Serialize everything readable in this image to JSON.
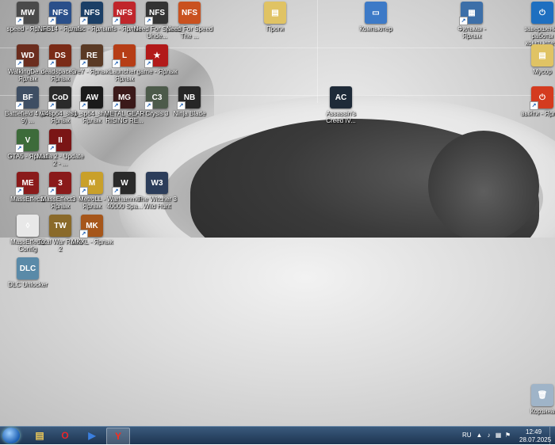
{
  "desktop": {
    "icons": [
      {
        "name": "speed-icon",
        "label": "speed - Ярлык",
        "glyph": "MW",
        "bg": "#4a4a4a",
        "shortcut": true
      },
      {
        "name": "nfs14-icon",
        "label": "NFS14 - Ярлык",
        "glyph": "NFS",
        "bg": "#2a4f8a",
        "shortcut": true
      },
      {
        "name": "nfsc-icon",
        "label": "nfsc - Ярлык",
        "glyph": "NFS",
        "bg": "#1b3f66",
        "shortcut": true
      },
      {
        "name": "nfs-icon",
        "label": "nfs - Ярлык",
        "glyph": "NFS",
        "bg": "#c0262b",
        "shortcut": true
      },
      {
        "name": "nfs-undercover-icon",
        "label": "Need For Speed Unde...",
        "glyph": "NFS",
        "bg": "#333333",
        "shortcut": true
      },
      {
        "name": "nfs-the-run-icon",
        "label": "Need For Speed The ...",
        "glyph": "NFS",
        "bg": "#c9511f",
        "shortcut": false
      },
      {
        "name": "walkingdead-icon",
        "label": "WalkingDe... - Ярлык",
        "glyph": "WD",
        "bg": "#6b2d1e",
        "shortcut": true
      },
      {
        "name": "deadspace3-icon",
        "label": "deadspace3 - Ярлык",
        "glyph": "DS",
        "bg": "#7a2b17",
        "shortcut": true
      },
      {
        "name": "re7-icon",
        "label": "re7 - Ярлык",
        "glyph": "RE",
        "bg": "#5a3a25",
        "shortcut": true
      },
      {
        "name": "launcher-icon",
        "label": "Launcher - Ярлык",
        "glyph": "L",
        "bg": "#b63d16",
        "shortcut": true
      },
      {
        "name": "game-icon",
        "label": "game - Ярлык",
        "glyph": "★",
        "bg": "#b21a1a",
        "shortcut": true
      },
      {
        "name": "battlefield4-icon",
        "label": "Battlefield 4 (DX 9) ...",
        "glyph": "BF",
        "bg": "#3e4e63",
        "shortcut": true
      },
      {
        "name": "mw2-ship-icon",
        "label": "iw4sp64_ship - Ярлык",
        "glyph": "CoD",
        "bg": "#2a2a2a",
        "shortcut": true
      },
      {
        "name": "s1-ship-icon",
        "label": "s1_sp64_ship - Ярлык",
        "glyph": "AW",
        "bg": "#1a1a1a",
        "shortcut": true
      },
      {
        "name": "metal-gear-icon",
        "label": "METAL GEAR RISING RE...",
        "glyph": "MG",
        "bg": "#3b1a1a",
        "shortcut": true
      },
      {
        "name": "crysis3-icon",
        "label": "Crysis 3",
        "glyph": "C3",
        "bg": "#4c5a4a",
        "shortcut": true
      },
      {
        "name": "ninja-blade-icon",
        "label": "Ninja Blade",
        "glyph": "NB",
        "bg": "#262626",
        "shortcut": true
      },
      {
        "name": "gta5-icon",
        "label": "GTA5 - Ярлык",
        "glyph": "V",
        "bg": "#3d6b3a",
        "shortcut": true
      },
      {
        "name": "mafia2-icon",
        "label": "Mafia 2 - Update 2 - ...",
        "glyph": "II",
        "bg": "#7a1515",
        "shortcut": true
      },
      {
        "name": "masseffect2-icon",
        "label": "MassEffect2",
        "glyph": "ME",
        "bg": "#8a1a1a",
        "shortcut": true
      },
      {
        "name": "masseffect3-icon",
        "label": "MassEffect3 - Ярлык",
        "glyph": "3",
        "bg": "#8a1a1a",
        "shortcut": true
      },
      {
        "name": "metro-icon",
        "label": "MetroLL - Ярлык",
        "glyph": "M",
        "bg": "#c9a02a",
        "shortcut": true
      },
      {
        "name": "warhammer-icon",
        "label": "Warhammer 40000 Spa...",
        "glyph": "W",
        "bg": "#2a2a2a",
        "shortcut": true
      },
      {
        "name": "witcher3-icon",
        "label": "The Witcher 3 Wild Hunt",
        "glyph": "W3",
        "bg": "#2c3d5a",
        "shortcut": false
      },
      {
        "name": "me2-config-icon",
        "label": "MassEffect2 Config",
        "glyph": "◊",
        "bg": "#e8e8e8",
        "shortcut": false
      },
      {
        "name": "total-war-icon",
        "label": "Total War Rome 2",
        "glyph": "TW",
        "bg": "#8a6a2a",
        "shortcut": false
      },
      {
        "name": "mkxl-icon",
        "label": "MKXL - Ярлык",
        "glyph": "MK",
        "bg": "#a6561a",
        "shortcut": true
      },
      {
        "name": "dlc-unlocker-icon",
        "label": "DLC Unlocker",
        "glyph": "DLC",
        "bg": "#5a8aa8",
        "shortcut": false
      },
      {
        "name": "progi-folder-icon",
        "label": "Проги",
        "glyph": "▤",
        "bg": "#e0c364",
        "shortcut": false
      },
      {
        "name": "computer-icon",
        "label": "Компьютер",
        "glyph": "▭",
        "bg": "#3d7ac7",
        "shortcut": false
      },
      {
        "name": "films-icon",
        "label": "Фильмы - Ярлык",
        "glyph": "▦",
        "bg": "#3d6fa8",
        "shortcut": true
      },
      {
        "name": "shutdown-icon",
        "label": "завершение работы компьюте...",
        "glyph": "⏻",
        "bg": "#1e6fc0",
        "shortcut": false
      },
      {
        "name": "musor-folder-icon",
        "label": "Мусор",
        "glyph": "▤",
        "bg": "#e0c364",
        "shortcut": false
      },
      {
        "name": "reboot-icon",
        "label": "выйти - Ярлык",
        "glyph": "⏻",
        "bg": "#d43b1f",
        "shortcut": true
      },
      {
        "name": "assassins-creed-icon",
        "label": "Assassin's Creed IV...",
        "glyph": "AC",
        "bg": "#1e2a38",
        "shortcut": false
      },
      {
        "name": "recycle-bin-icon",
        "label": "Корзина",
        "glyph": "🗑",
        "bg": "#9fb4c8",
        "shortcut": false
      }
    ]
  },
  "taskbar": {
    "items": [
      {
        "name": "explorer-taskbar-icon",
        "glyph": "▤",
        "color": "#e8c65a",
        "active": false
      },
      {
        "name": "opera-taskbar-icon",
        "glyph": "O",
        "color": "#e8262b",
        "active": false
      },
      {
        "name": "app-taskbar-icon",
        "glyph": "▶",
        "color": "#3a7fe0",
        "active": false
      },
      {
        "name": "yandex-taskbar-icon",
        "glyph": "Y",
        "color": "#ff2a1a",
        "active": true
      }
    ],
    "language": "RU",
    "time": "12:49",
    "date": "28.07.2025"
  }
}
